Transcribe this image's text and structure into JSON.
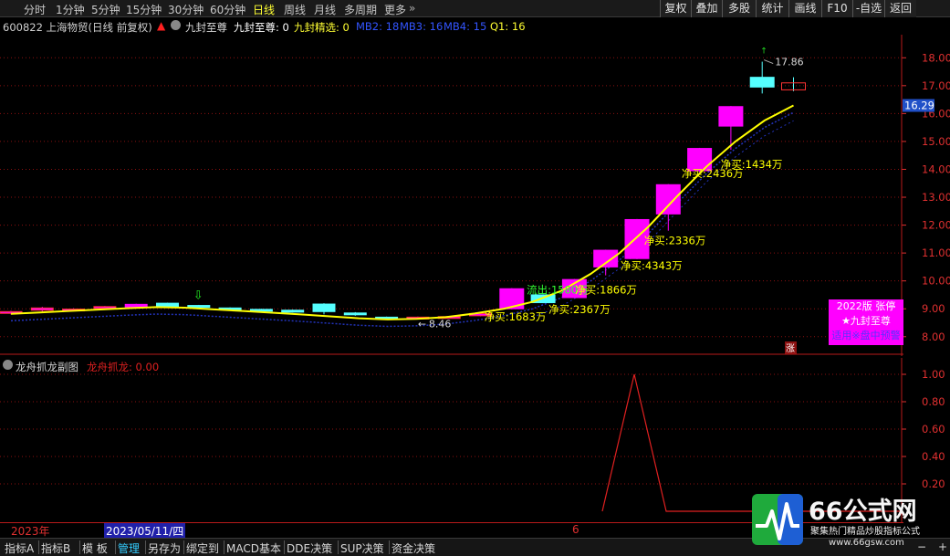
{
  "top_bar": {
    "periods": [
      "分时",
      "1分钟",
      "5分钟",
      "15分钟",
      "30分钟",
      "60分钟",
      "日线",
      "周线",
      "月线",
      "多周期",
      "更多"
    ],
    "active_period": "日线",
    "right_buttons": [
      "复权",
      "叠加",
      "多股",
      "统计",
      "画线",
      "F10",
      "-自选",
      "返回"
    ]
  },
  "info_bar": {
    "stock": "600822 上海物贸(日线 前复权)",
    "indicator_name": "九封至尊",
    "indicator_value": "九封至尊: 0",
    "select_label": "九封精选: 0",
    "mb2": "MB2: 18",
    "mb3": "MB3: 16",
    "mb4": "MB4: 15",
    "q1": "Q1: 16"
  },
  "sub_info": {
    "name": "龙舟抓龙副图",
    "value": "龙舟抓龙: 0.00"
  },
  "colors": {
    "up_candle": "#ff00ff",
    "down_candle": "#55ffff",
    "ma_line": "#ffff00",
    "grid": "#8b1010",
    "axis_text": "#e03030",
    "sub_line": "#e02020"
  },
  "chart_data": [
    {
      "type": "candlestick",
      "y_ticks": [
        "18.00",
        "17.00",
        "16.00",
        "15.00",
        "14.00",
        "13.00",
        "12.00",
        "11.00",
        "10.00",
        "9.00",
        "8.00"
      ],
      "ylim": [
        7.6,
        18.5
      ],
      "current_price": "16.29",
      "high_label": "17.86",
      "low_label": "8.46",
      "low_arrow": "←",
      "high_arrow": "↑",
      "candles": [
        {
          "i": 0,
          "o": 8.85,
          "c": 8.9,
          "h": 8.93,
          "l": 8.8
        },
        {
          "i": 1,
          "o": 8.95,
          "c": 9.03,
          "h": 9.07,
          "l": 8.9
        },
        {
          "i": 2,
          "o": 8.98,
          "c": 8.99,
          "h": 9.02,
          "l": 8.95
        },
        {
          "i": 3,
          "o": 9.02,
          "c": 9.08,
          "h": 9.1,
          "l": 9.0
        },
        {
          "i": 4,
          "o": 9.06,
          "c": 9.16,
          "h": 9.18,
          "l": 9.04
        },
        {
          "i": 5,
          "o": 9.2,
          "c": 9.05,
          "h": 9.22,
          "l": 9.03
        },
        {
          "i": 6,
          "o": 9.12,
          "c": 9.05,
          "h": 9.14,
          "l": 9.02
        },
        {
          "i": 7,
          "o": 9.03,
          "c": 8.96,
          "h": 9.05,
          "l": 8.93
        },
        {
          "i": 8,
          "o": 8.98,
          "c": 8.94,
          "h": 9.0,
          "l": 8.9
        },
        {
          "i": 9,
          "o": 8.95,
          "c": 8.88,
          "h": 8.97,
          "l": 8.86
        },
        {
          "i": 10,
          "o": 9.17,
          "c": 8.9,
          "h": 9.2,
          "l": 8.8
        },
        {
          "i": 11,
          "o": 8.85,
          "c": 8.8,
          "h": 8.88,
          "l": 8.75
        },
        {
          "i": 12,
          "o": 8.7,
          "c": 8.68,
          "h": 8.72,
          "l": 8.65
        },
        {
          "i": 13,
          "o": 8.68,
          "c": 8.7,
          "h": 8.72,
          "l": 8.62
        },
        {
          "i": 14,
          "o": 8.7,
          "c": 8.72,
          "h": 8.74,
          "l": 8.67
        },
        {
          "i": 15,
          "o": 8.75,
          "c": 8.83,
          "h": 8.85,
          "l": 8.73
        },
        {
          "i": 16,
          "o": 9.0,
          "c": 9.72,
          "h": 9.74,
          "l": 8.98
        },
        {
          "i": 17,
          "o": 9.5,
          "c": 9.22,
          "h": 9.52,
          "l": 9.2
        },
        {
          "i": 18,
          "o": 9.4,
          "c": 10.05,
          "h": 10.07,
          "l": 9.38
        },
        {
          "i": 19,
          "o": 10.5,
          "c": 11.1,
          "h": 11.12,
          "l": 10.2
        },
        {
          "i": 20,
          "o": 10.8,
          "c": 12.2,
          "h": 12.22,
          "l": 10.78
        },
        {
          "i": 21,
          "o": 12.4,
          "c": 13.45,
          "h": 13.47,
          "l": 11.8
        },
        {
          "i": 22,
          "o": 13.95,
          "c": 14.75,
          "h": 14.77,
          "l": 13.9
        },
        {
          "i": 23,
          "o": 15.55,
          "c": 16.25,
          "h": 16.27,
          "l": 14.7
        },
        {
          "i": 24,
          "o": 17.3,
          "c": 16.95,
          "h": 17.86,
          "l": 16.72
        },
        {
          "i": 25,
          "o": 17.1,
          "c": 16.85,
          "h": 17.3,
          "l": 16.8
        }
      ],
      "ma": [
        8.82,
        8.87,
        8.92,
        8.97,
        9.02,
        9.06,
        9.04,
        8.98,
        8.92,
        8.86,
        8.8,
        8.73,
        8.66,
        8.62,
        8.64,
        8.7,
        8.83,
        9.0,
        9.25,
        9.65,
        10.25,
        11.0,
        11.95,
        13.05,
        14.1,
        15.0,
        15.75,
        16.29
      ],
      "annotations": [
        {
          "text": "净买:1683万",
          "price": 8.72,
          "i": 16.0
        },
        {
          "text": "流出:1580万",
          "price": 9.68,
          "i": 17.35,
          "color": "#33ff33"
        },
        {
          "text": "净买:1866万",
          "price": 9.68,
          "i": 18.9
        },
        {
          "text": "净买:2367万",
          "price": 8.97,
          "i": 18.05
        },
        {
          "text": "净买:4343万",
          "price": 10.55,
          "i": 20.35
        },
        {
          "text": "净买:2336万",
          "price": 11.45,
          "i": 21.1
        },
        {
          "text": "净买:2436万",
          "price": 13.85,
          "i": 22.3
        },
        {
          "text": "净买:1434万",
          "price": 14.18,
          "i": 23.55
        }
      ],
      "signals": [
        {
          "label": "涨",
          "i": 23.0
        }
      ],
      "ad_lines": [
        "2022版 张停",
        "★九封至尊",
        "适用※盘中预警"
      ]
    },
    {
      "type": "line",
      "title": "龙舟抓龙",
      "y_ticks": [
        "1.00",
        "0.80",
        "0.60",
        "0.40",
        "0.20"
      ],
      "ylim": [
        0,
        1.1
      ],
      "values_x": [
        0,
        19,
        20,
        21,
        28
      ],
      "values": [
        0,
        0,
        1.0,
        0,
        0
      ],
      "x_start_index": 19
    }
  ],
  "dates": {
    "year_label": "2023年",
    "selected_date": "2023/05/11/四",
    "month_label": "6"
  },
  "bottom_tabs": [
    "指标A",
    "指标B",
    "模 板",
    "管理",
    "另存为",
    "绑定到",
    "MACD基本",
    "DDE决策",
    "SUP决策",
    "资金决策"
  ],
  "active_tab": "管理",
  "watermark": {
    "brand": "66公式网",
    "slogan": "聚集热门精品炒股指标公式",
    "url": "www.66gsw.com"
  }
}
